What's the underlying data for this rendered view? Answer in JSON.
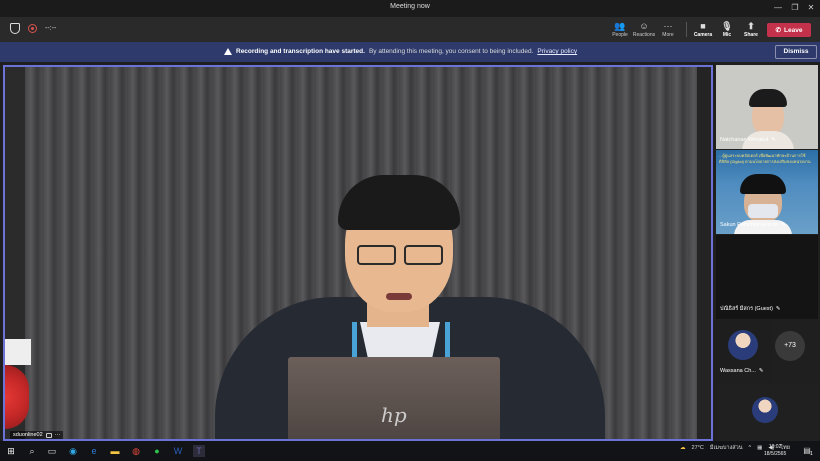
{
  "window": {
    "title": "Meeting now",
    "minimize": "—",
    "maximize": "❐",
    "close": "✕"
  },
  "toolbar": {
    "timer": "--:--",
    "people": "People",
    "reactions": "Reactions",
    "more": "More",
    "camera": "Camera",
    "mic": "Mic",
    "share": "Share",
    "leave": "Leave"
  },
  "banner": {
    "bold": "Recording and transcription have started.",
    "text": "By attending this meeting, you consent to being included.",
    "link": "Privacy policy",
    "dismiss": "Dismiss"
  },
  "main_video": {
    "name": "sduonline02"
  },
  "participants": [
    {
      "name": "Natchanan Werakul"
    },
    {
      "name": "Sakun Panichjarsennan"
    },
    {
      "name": "ปณิธิสร์ มีสกร (Guest)"
    },
    {
      "name": "Wassana Ch..."
    }
  ],
  "more_count": "+73",
  "tile2_banner": "...ผู้ดูแลระบบคลัสเตอร์ เพื่อพัฒนาทักษะด้านการใช้ดิจิทัล (Digital) ตามนโยบายการส่งเสริมของหน่วยงาน",
  "taskbar": {
    "weather": "27°C",
    "weather_desc": "มีเมฆบางส่วน",
    "lang": "ไทย",
    "time": "10:02",
    "date": "18/5/2565",
    "notif": "1"
  }
}
